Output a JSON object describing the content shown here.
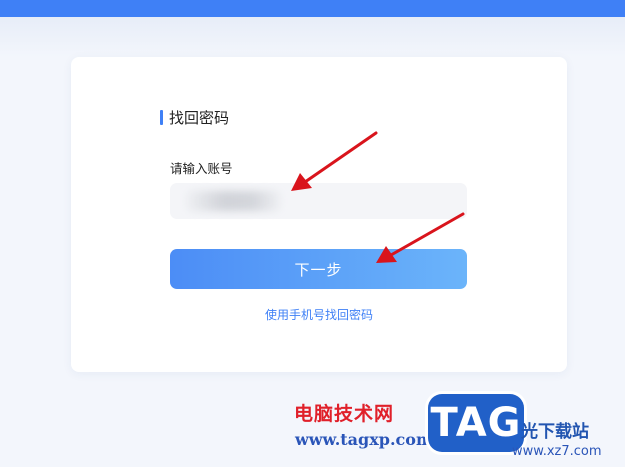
{
  "recovery": {
    "title": "找回密码",
    "account_label": "请输入账号",
    "account_value": "",
    "account_placeholder": "",
    "next_label": "下一步",
    "phone_link": "使用手机号找回密码"
  },
  "colors": {
    "accent": "#3f80f6",
    "arrow": "#d9141c"
  },
  "watermark": {
    "cn": "电脑技术网",
    "url": "www.tagxp.com",
    "logo": "TAG",
    "site": "光下载站",
    "site_url": "www.xz7.com"
  }
}
